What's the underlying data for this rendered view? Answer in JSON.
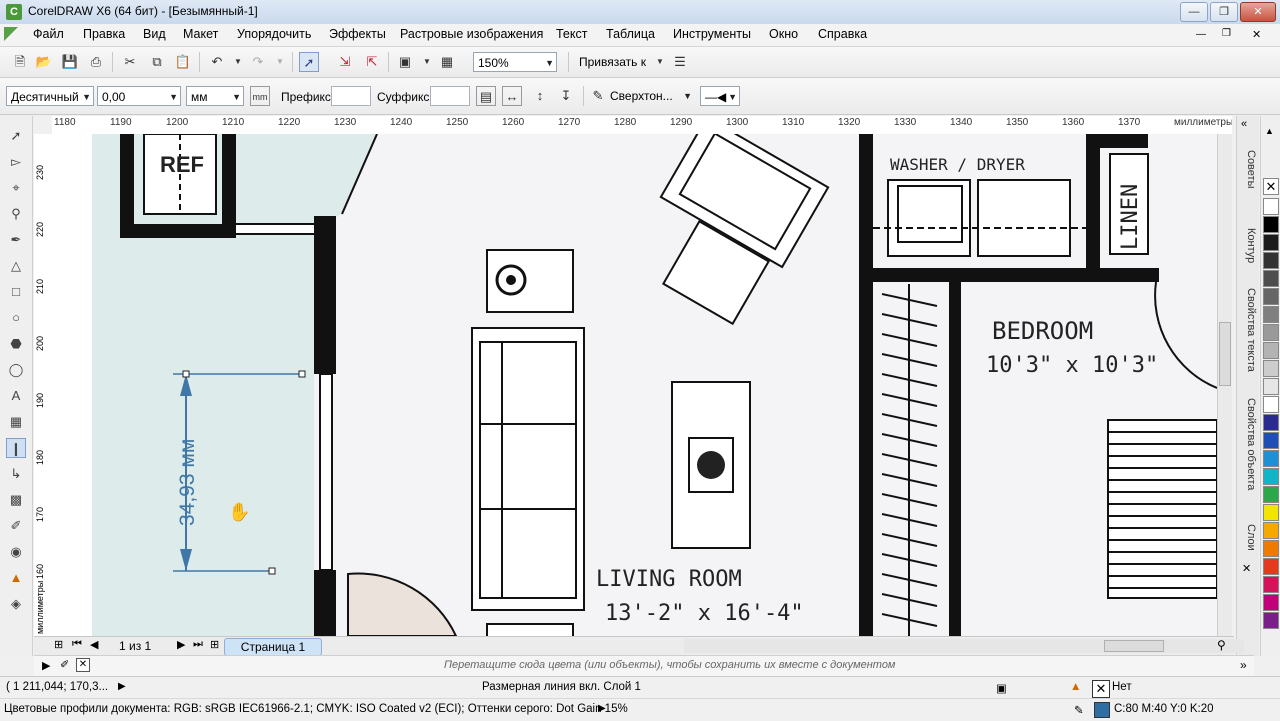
{
  "window": {
    "title": "CorelDRAW X6 (64 бит) - [Безымянный-1]"
  },
  "menu": [
    "Файл",
    "Правка",
    "Вид",
    "Макет",
    "Упорядочить",
    "Эффекты",
    "Растровые изображения",
    "Текст",
    "Таблица",
    "Инструменты",
    "Окно",
    "Справка"
  ],
  "toolbar": {
    "zoom": "150%",
    "snap": "Привязать к"
  },
  "propbar": {
    "style": "Десятичный",
    "precision": "0,00",
    "units": "мм",
    "prefix_label": "Префикс:",
    "suffix_label": "Суффикс:",
    "text_position": "Сверхтон..."
  },
  "ruler": {
    "h_numbers": [
      "1180",
      "1190",
      "1200",
      "1210",
      "1220",
      "1230",
      "1240",
      "1250",
      "1260",
      "1270",
      "1280",
      "1290",
      "1300",
      "1310",
      "1320",
      "1330",
      "1340",
      "1350",
      "1360",
      "1370"
    ],
    "h_unit": "миллиметры",
    "v_numbers": [
      "230",
      "220",
      "210",
      "200",
      "190",
      "180",
      "170",
      "160"
    ],
    "v_unit": "миллиметры"
  },
  "drawing": {
    "dimension": "34,93 мм",
    "ref": "REF",
    "washer": "WASHER / DRYER",
    "linen": "LINEN",
    "bedroom": "BEDROOM",
    "bedroom_size": "10'3\" x 10'3\"",
    "living": "LIVING ROOM",
    "living_size": "13'-2\" x 16'-4\""
  },
  "dockers": [
    "Советы",
    "Контур",
    "Свойства текста",
    "Свойства объекта",
    "Слои"
  ],
  "pages": {
    "counter": "1 из 1",
    "tab": "Страница 1"
  },
  "colorbar": {
    "hint": "Перетащите сюда цвета (или объекты), чтобы сохранить их вместе с документом"
  },
  "status": {
    "coords": "( 1 211,044; 170,3...",
    "object": "Размерная линия вкл. Слой 1",
    "fill": "Нет",
    "profiles": "Цветовые профили документа: RGB: sRGB IEC61966-2.1; CMYK: ISO Coated v2 (ECI); Оттенки серого: Dot Gain 15%",
    "outline": "C:80 M:40 Y:0 K:20"
  },
  "palette_colors": [
    "#ffffff",
    "#000000",
    "#1a1a1a",
    "#333333",
    "#4d4d4d",
    "#666666",
    "#808080",
    "#999999",
    "#b3b3b3",
    "#cccccc",
    "#e6e6e6",
    "#ffffff",
    "#2b2b8f",
    "#1f4fb5",
    "#1e90d6",
    "#12b5c5",
    "#2aa84a",
    "#f2e600",
    "#f7a800",
    "#ee7a00",
    "#e53a20",
    "#d4145a",
    "#c2007a",
    "#7a1f8a"
  ]
}
